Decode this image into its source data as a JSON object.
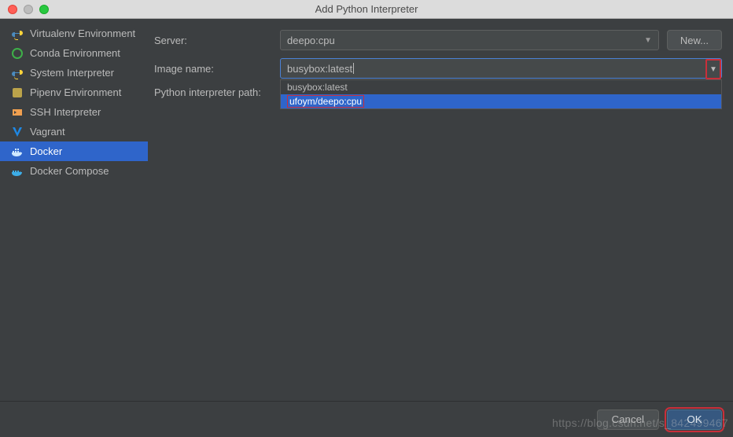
{
  "window": {
    "title": "Add Python Interpreter"
  },
  "sidebar": {
    "items": [
      {
        "label": "Virtualenv Environment",
        "icon": "python-icon"
      },
      {
        "label": "Conda Environment",
        "icon": "conda-icon"
      },
      {
        "label": "System Interpreter",
        "icon": "python-icon"
      },
      {
        "label": "Pipenv Environment",
        "icon": "pipenv-icon"
      },
      {
        "label": "SSH Interpreter",
        "icon": "ssh-icon"
      },
      {
        "label": "Vagrant",
        "icon": "vagrant-icon"
      },
      {
        "label": "Docker",
        "icon": "docker-icon",
        "selected": true
      },
      {
        "label": "Docker Compose",
        "icon": "docker-compose-icon"
      }
    ]
  },
  "form": {
    "server_label": "Server:",
    "server_value": "deepo:cpu",
    "new_button": "New...",
    "image_label": "Image name:",
    "image_value": "busybox:latest",
    "path_label": "Python interpreter path:",
    "dropdown": {
      "options": [
        {
          "label": "busybox:latest",
          "highlighted": false
        },
        {
          "label": "ufoym/deepo:cpu",
          "highlighted": true
        }
      ]
    }
  },
  "footer": {
    "cancel": "Cancel",
    "ok": "OK"
  },
  "watermark": "https://blog.csdn.net/s_842499467"
}
